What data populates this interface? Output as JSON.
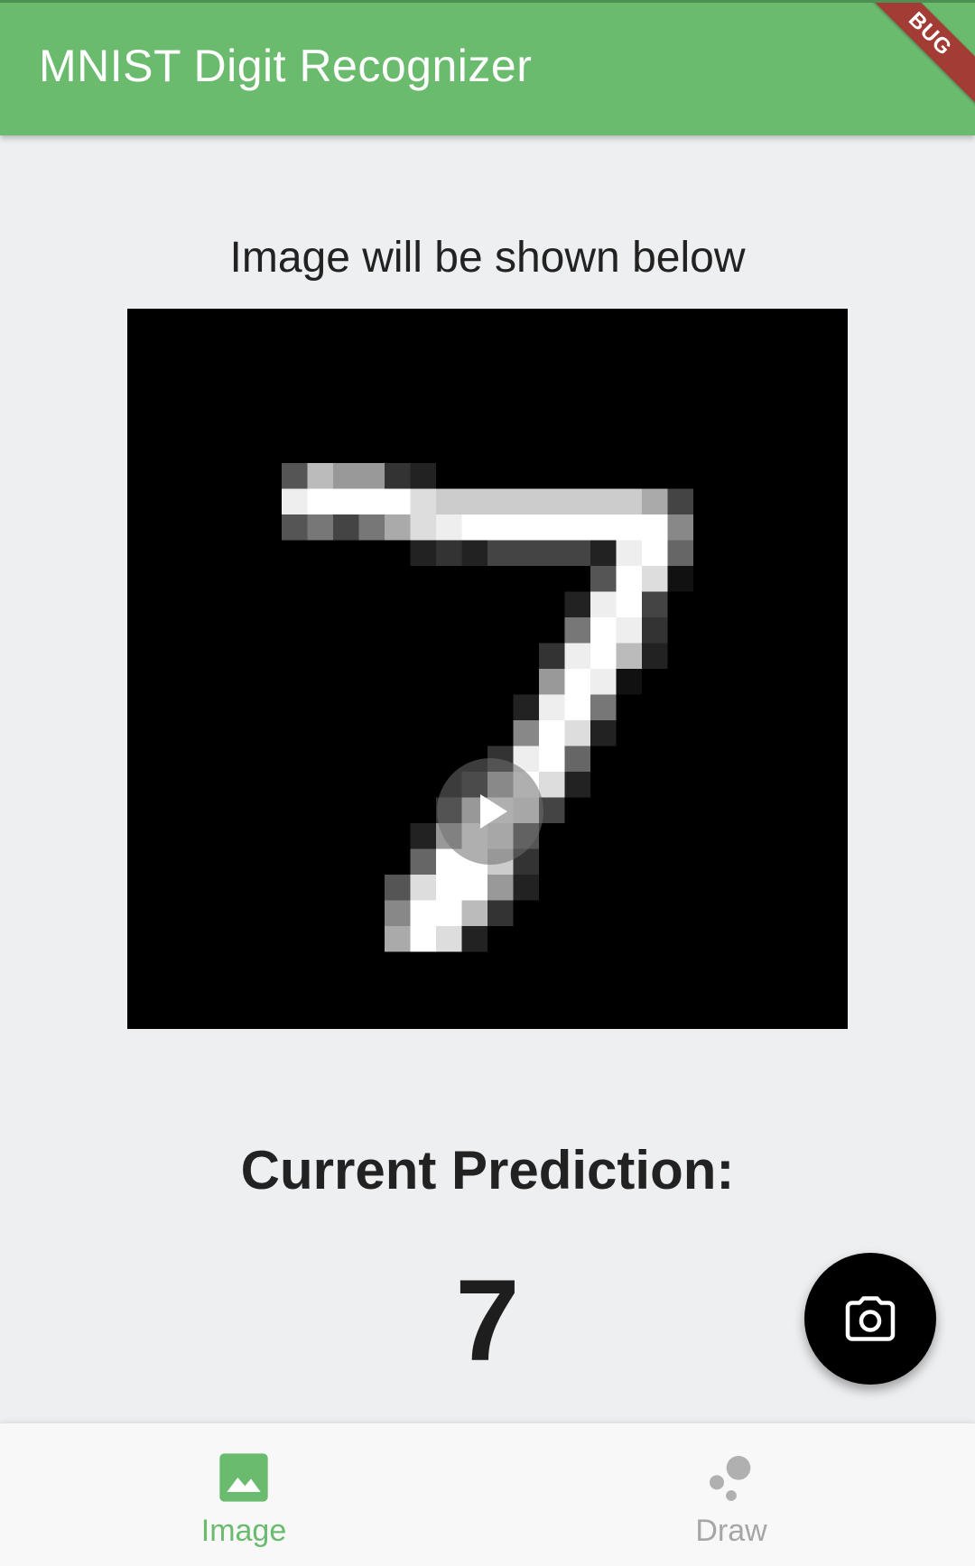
{
  "app_bar": {
    "title": "MNIST Digit Recognizer",
    "color": "#6bbb6f",
    "debug_banner": "BUG"
  },
  "main": {
    "caption": "Image will be shown below",
    "image_icon": "digit-seven-image",
    "prediction_label": "Current Prediction:",
    "prediction_value": "7"
  },
  "fab": {
    "icon": "camera-icon",
    "color": "#000000"
  },
  "bottom_nav": {
    "items": [
      {
        "label": "Image",
        "icon": "image-icon",
        "selected": true,
        "color": "#6bbb6f"
      },
      {
        "label": "Draw",
        "icon": "draw-dots-icon",
        "selected": false,
        "color": "#a6a6a6"
      }
    ]
  }
}
